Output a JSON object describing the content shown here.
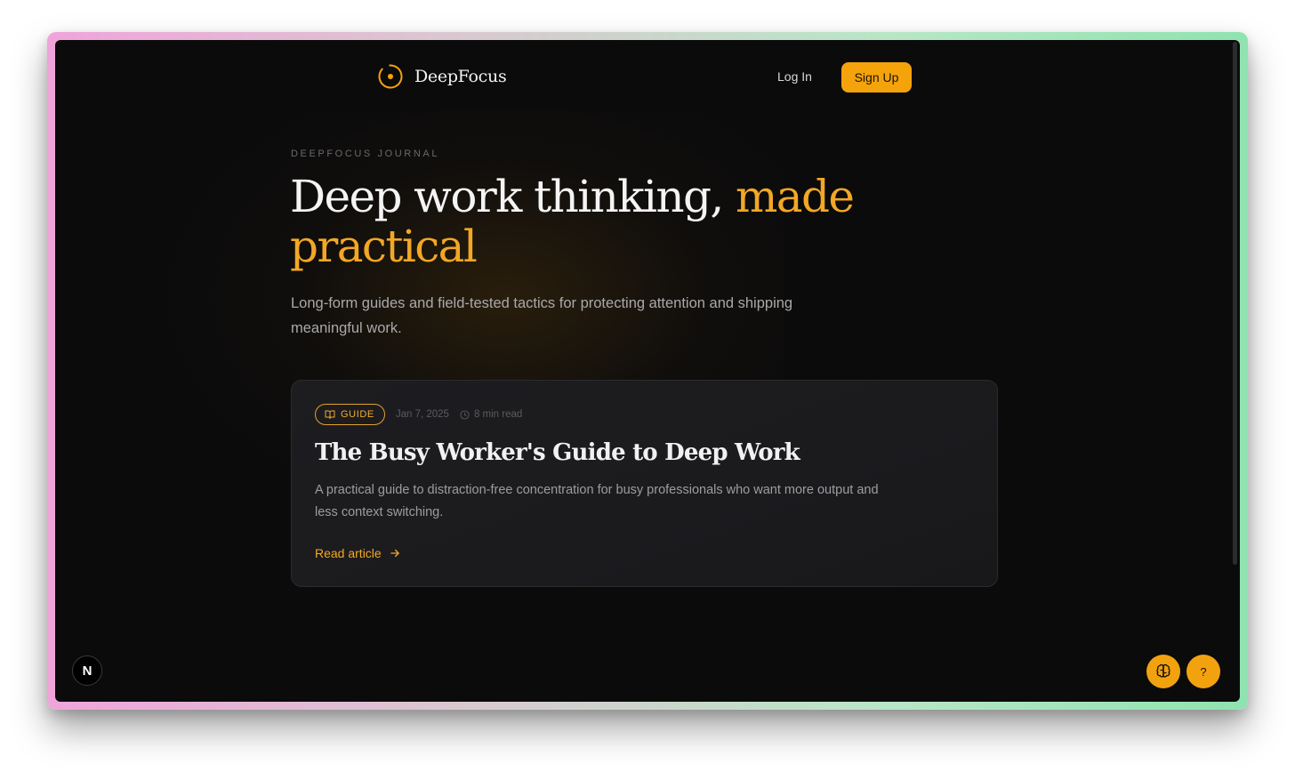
{
  "brand": {
    "name": "DeepFocus",
    "icon": "target-circle-icon",
    "accent": "#f5a30b"
  },
  "nav": {
    "login_label": "Log In",
    "signup_label": "Sign Up"
  },
  "hero": {
    "eyebrow": "DEEPFOCUS JOURNAL",
    "headline_main": "Deep work thinking, ",
    "headline_accent": "made practical",
    "subtitle": "Long-form guides and field-tested tactics for protecting attention and shipping meaningful work."
  },
  "article": {
    "tag": "GUIDE",
    "tag_icon": "book-open-icon",
    "date": "Jan 7, 2025",
    "read_time": "8 min read",
    "title": "The Busy Worker's Guide to Deep Work",
    "description": "A practical guide to distraction-free concentration for busy professionals who want more output and less context switching.",
    "link_label": "Read article"
  },
  "floating": {
    "n_badge": "N",
    "brain_icon": "brain-icon",
    "help_label": "?"
  },
  "colors": {
    "background": "#0b0b0c",
    "card": "#1c1c1f",
    "accent": "#f2a726"
  }
}
